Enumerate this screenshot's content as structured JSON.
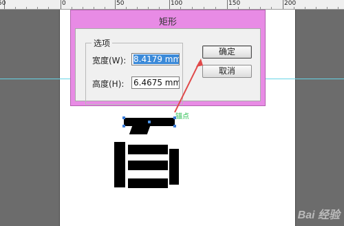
{
  "ruler": {
    "labels": [
      "50",
      "0",
      "50",
      "100",
      "150",
      "200"
    ]
  },
  "dialog": {
    "title": "矩形",
    "group_label": "选项",
    "width_label": "宽度(W):",
    "width_value": "8.4179 mm",
    "height_label": "高度(H):",
    "height_value": "6.4675 mm",
    "ok_label": "确定",
    "cancel_label": "取消"
  },
  "annotation": {
    "anchor_label": "锚点"
  },
  "watermark": "Bai 经验"
}
